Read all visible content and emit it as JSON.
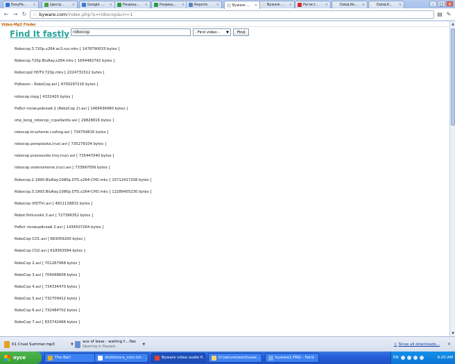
{
  "tabs": [
    {
      "title": "EasyPa...",
      "color": "#2b6fd6",
      "active": false
    },
    {
      "title": "Центр...",
      "color": "#41a340",
      "active": false
    },
    {
      "title": "Google ...",
      "color": "#3a7bd5",
      "active": false
    },
    {
      "title": "Разреш...",
      "color": "#2b9c3c",
      "active": false
    },
    {
      "title": "Разреш...",
      "color": "#2b9c3c",
      "active": false
    },
    {
      "title": "Reports",
      "color": "#5a7fbf",
      "active": false
    },
    {
      "title": "Byware ...",
      "color": "#dddddd",
      "active": true
    },
    {
      "title": "Byware ...",
      "color": "#dddddd",
      "active": false
    },
    {
      "title": "Регист...",
      "color": "#d22b2b",
      "active": false
    },
    {
      "title": "DataLife...",
      "color": "#e8e8e8",
      "active": false
    },
    {
      "title": "DataLif...",
      "color": "#e8e8e8",
      "active": false
    }
  ],
  "address": {
    "host": "byware.com",
    "path": "/index.php?s=robocop&cn=1"
  },
  "site": {
    "name": "Video-Mp3 Finder",
    "logo": "Find It fastly"
  },
  "search": {
    "value": "robocop",
    "select_value": "- Find video -",
    "button_label": "Find"
  },
  "results": [
    "Robocop.3.720p.x264.ac3.rus.mkv [ 1478790033 bytes ]",
    "Robocop.720p.BluRay.x264.mkv [ 1654482742 bytes ]",
    "Robocop2.HDTV.720p.mkv [ 2224731512 bytes ]",
    "Робокоп - RoboCop.avi [ 4700297216 bytes ]",
    "robocop.mpg [ 4332420 bytes ]",
    "Робот-полицейский 2 (RoboCop 2).avi [ 1468436480 bytes ]",
    "ohp_kong_robocop_ccpatlantis.avi [ 29828816 bytes ]",
    "robocop.krushenie.i.ozhog.avi [ 734754816 bytes ]",
    "robocop.pereplavka.(rus).avi [ 735279104 bytes ]",
    "robocop.pravosudie.tmy.(rus).avi [ 735447040 bytes ]",
    "robocop.voskreshenie.(rus).avi [ 733997056 bytes ]",
    "Robocop.2.1990.BluRay.1080p.DTS.x264-CHD.mkv [ 15712417208 bytes ]",
    "Robocop.3.1993.BluRay.1080p.DTS.x264-CHD.mkv [ 12288455230 bytes ]",
    "Robocop (HDTV).avi [ 4811128832 bytes ]",
    "Robot.Policeiskii.3.avi [ 727396352 bytes ]",
    "Робот полицейский 2.avi [ 1434507264 bytes ]",
    "RoboCop CD1.avi [ 683059200 bytes ]",
    "RoboCop CD2.avi [ 618563584 bytes ]",
    "RoboCop 2.avi [ 701267968 bytes ]",
    "RoboCop 3.avi [ 704068608 bytes ]",
    "RoboCop 4.avi [ 734334470 bytes ]",
    "RoboCop 5.avi [ 732709412 bytes ]",
    "RoboCop 6.avi [ 732484702 bytes ]",
    "RoboCop 7.avi [ 833742466 bytes ]"
  ],
  "downloads": {
    "item1": {
      "name": "01 Cruel Summer.mp3",
      "color": "#e5a020"
    },
    "item2": {
      "name": "ace of base - waiting f....flac",
      "status": "Opening in Paused...",
      "color": "#6a8fd0"
    },
    "show_all": "Show all downloads..."
  },
  "taskbar": {
    "start_label": "пуск",
    "tasks": [
      {
        "title": "The Bat!",
        "color": "#d9b030"
      },
      {
        "title": "zhshimora_com.txt - ...",
        "color": "#ffffff"
      },
      {
        "title": "Byware video audio fi...",
        "color": "#dd4433"
      },
      {
        "title": "D:\\secure\\work\\sear...",
        "color": "#f2d36b"
      },
      {
        "title": "byware1.PNG - Paint",
        "color": "#7fb0e8"
      }
    ],
    "lang": "EN",
    "clock": "9:20 AM"
  }
}
